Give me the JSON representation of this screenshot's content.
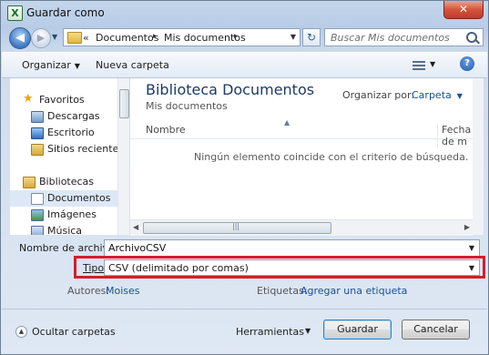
{
  "window": {
    "title": "Guardar como",
    "app_icon_glyph": "X",
    "close_glyph": "✕"
  },
  "nav": {
    "back_glyph": "◀",
    "forward_glyph": "▶",
    "path_chevron": "«",
    "crumbs": [
      "Documentos",
      "Mis documentos"
    ],
    "crumb_separator": "▸",
    "refresh_glyph": "↻",
    "search_placeholder": "Buscar Mis documentos"
  },
  "toolbar": {
    "organize_label": "Organizar",
    "new_folder_label": "Nueva carpeta"
  },
  "sidebar": {
    "items": [
      {
        "label": "Favoritos",
        "icon": "star-icon",
        "level": 0
      },
      {
        "label": "Descargas",
        "icon": "downloads-icon",
        "level": 1
      },
      {
        "label": "Escritorio",
        "icon": "desktop-icon",
        "level": 1
      },
      {
        "label": "Sitios recientes",
        "icon": "recent-places-icon",
        "level": 1
      },
      {
        "label": "Bibliotecas",
        "icon": "libraries-icon",
        "level": 0
      },
      {
        "label": "Documentos",
        "icon": "documents-icon",
        "level": 1,
        "selected": true
      },
      {
        "label": "Imágenes",
        "icon": "pictures-icon",
        "level": 1
      },
      {
        "label": "Música",
        "icon": "music-icon",
        "level": 1
      }
    ]
  },
  "library": {
    "title": "Biblioteca Documentos",
    "subtitle": "Mis documentos",
    "arrange_label": "Organizar por:",
    "arrange_value": "Carpeta",
    "columns": [
      "Nombre",
      "Fecha de m"
    ],
    "empty_message": "Ningún elemento coincide con el criterio de búsqueda."
  },
  "form": {
    "filename_label": "Nombre de archivo:",
    "filename_value": "ArchivoCSV",
    "type_label": "Tipo:",
    "type_value": "CSV (delimitado por comas)",
    "authors_label": "Autores:",
    "authors_value": "Moises",
    "tags_label": "Etiquetas:",
    "tags_value": "Agregar una etiqueta"
  },
  "footer": {
    "hide_folders": "Ocultar carpetas",
    "tools": "Herramientas",
    "save": "Guardar",
    "cancel": "Cancelar"
  },
  "colors": {
    "highlight_box": "#d21f2b",
    "library_title": "#1e3a6a",
    "link": "#1a4fa0"
  }
}
